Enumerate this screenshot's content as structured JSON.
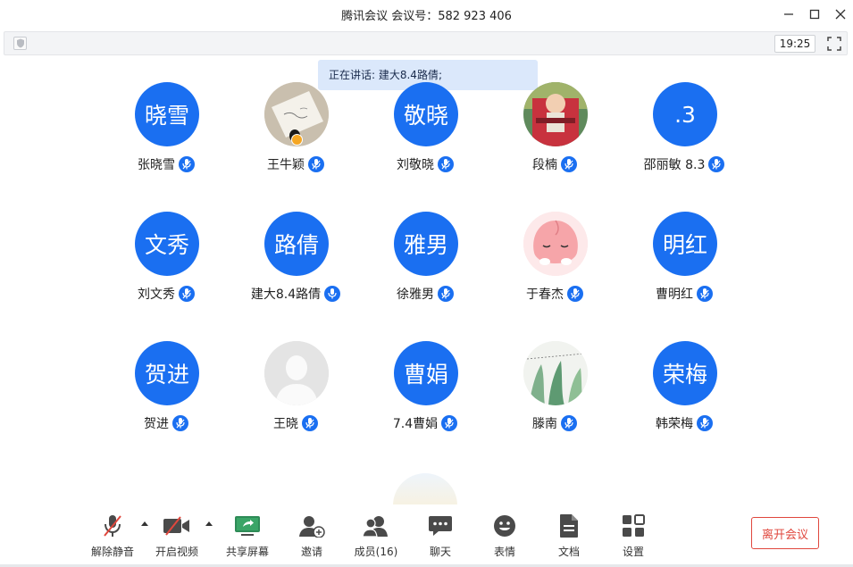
{
  "window": {
    "title": "腾讯会议  会议号：582 923 406",
    "minimize": "—",
    "maximize": "☐",
    "close": "✕"
  },
  "infobar": {
    "time": "19:25"
  },
  "speaking": {
    "text": "正在讲话: 建大8.4路倩;"
  },
  "participants": [
    {
      "avatar_text": "晓雪",
      "name": "张晓雪",
      "photo": false
    },
    {
      "avatar_text": "",
      "name": "王牛颖",
      "photo": true,
      "host": true
    },
    {
      "avatar_text": "敬晓",
      "name": "刘敬晓",
      "photo": false
    },
    {
      "avatar_text": "",
      "name": "段楠",
      "photo": true
    },
    {
      "avatar_text": ".3",
      "name": "邵丽敏 8.3",
      "photo": false
    },
    {
      "avatar_text": "文秀",
      "name": "刘文秀",
      "photo": false
    },
    {
      "avatar_text": "路倩",
      "name": "建大8.4路倩",
      "photo": false,
      "speaking": true
    },
    {
      "avatar_text": "雅男",
      "name": "徐雅男",
      "photo": false
    },
    {
      "avatar_text": "",
      "name": "于春杰",
      "photo": true
    },
    {
      "avatar_text": "明红",
      "name": "曹明红",
      "photo": false
    },
    {
      "avatar_text": "贺进",
      "name": "贺进",
      "photo": false
    },
    {
      "avatar_text": "",
      "name": "王晓",
      "photo": true
    },
    {
      "avatar_text": "曹娟",
      "name": "7.4曹娟",
      "photo": false
    },
    {
      "avatar_text": "",
      "name": "滕南",
      "photo": true
    },
    {
      "avatar_text": "荣梅",
      "name": "韩荣梅",
      "photo": false
    }
  ],
  "toolbar": {
    "unmute": "解除静音",
    "start_video": "开启视频",
    "share_screen": "共享屏幕",
    "invite": "邀请",
    "members": "成员(16)",
    "chat": "聊天",
    "emoji": "表情",
    "docs": "文档",
    "settings": "设置",
    "leave": "离开会议"
  },
  "colors": {
    "accent": "#1a6ff1",
    "leave": "#e0473d",
    "speaking_bg": "#dbe8fb"
  }
}
